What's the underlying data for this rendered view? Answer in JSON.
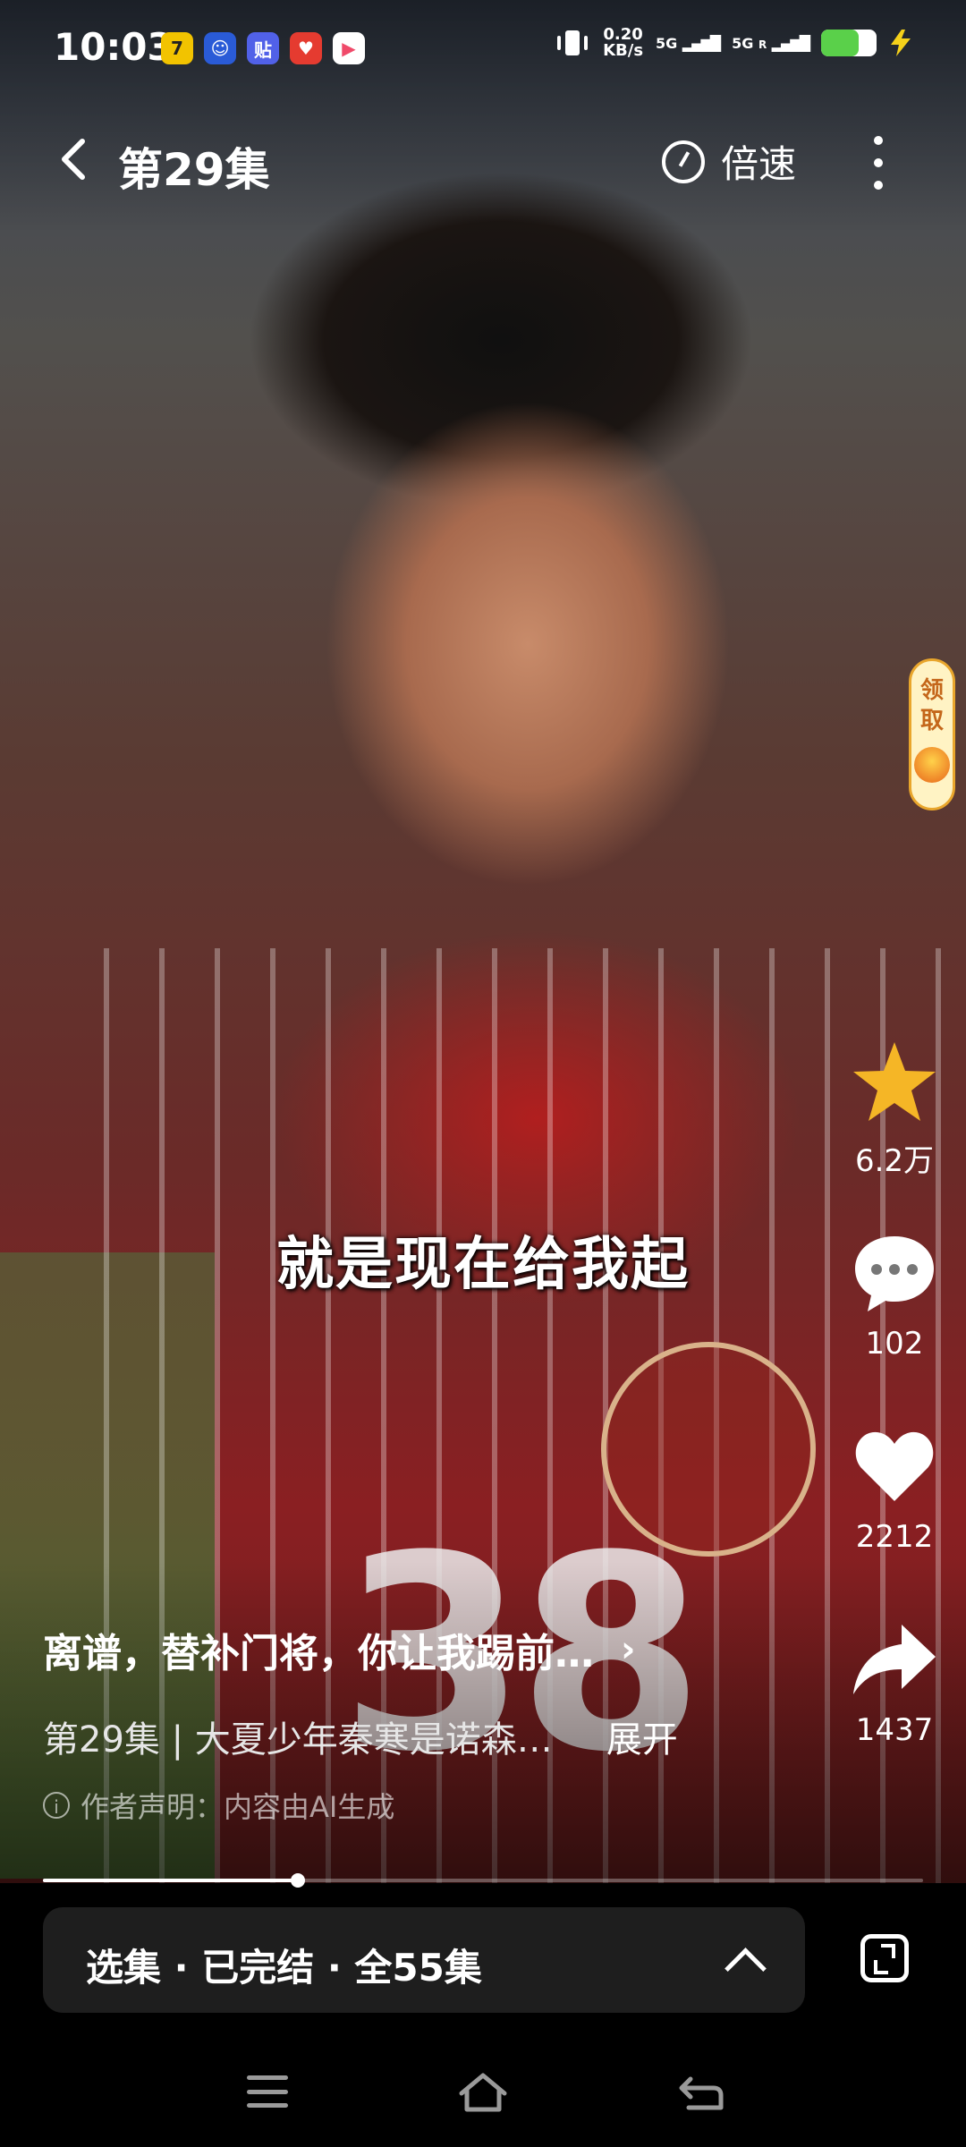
{
  "status_bar": {
    "time": "10:03",
    "net_speed_value": "0.20",
    "net_speed_unit": "KB/s",
    "signal_1": "5G",
    "signal_2": "5G",
    "roaming": "R"
  },
  "nav": {
    "episode_title": "第29集",
    "speed_label": "倍速"
  },
  "reward_badge": {
    "label_line1": "领",
    "label_line2": "取"
  },
  "subtitle": "就是现在给我起",
  "actions": {
    "favorite_count": "6.2万",
    "comment_count": "102",
    "like_count": "2212",
    "share_count": "1437"
  },
  "description": {
    "title": "离谱，替补门将，你让我踢前…",
    "episode_line": "第29集 | 大夏少年秦寒是诺森…",
    "expand_label": "展开",
    "disclaimer": "作者声明：内容由AI生成"
  },
  "progress": {
    "fraction": 0.29
  },
  "episode_bar": {
    "label": "选集 · 已完结 · 全55集"
  },
  "colors": {
    "favorite_star": "#f5b626",
    "reward_text": "#c4661a",
    "panel_bg": "#1e1e1e"
  }
}
